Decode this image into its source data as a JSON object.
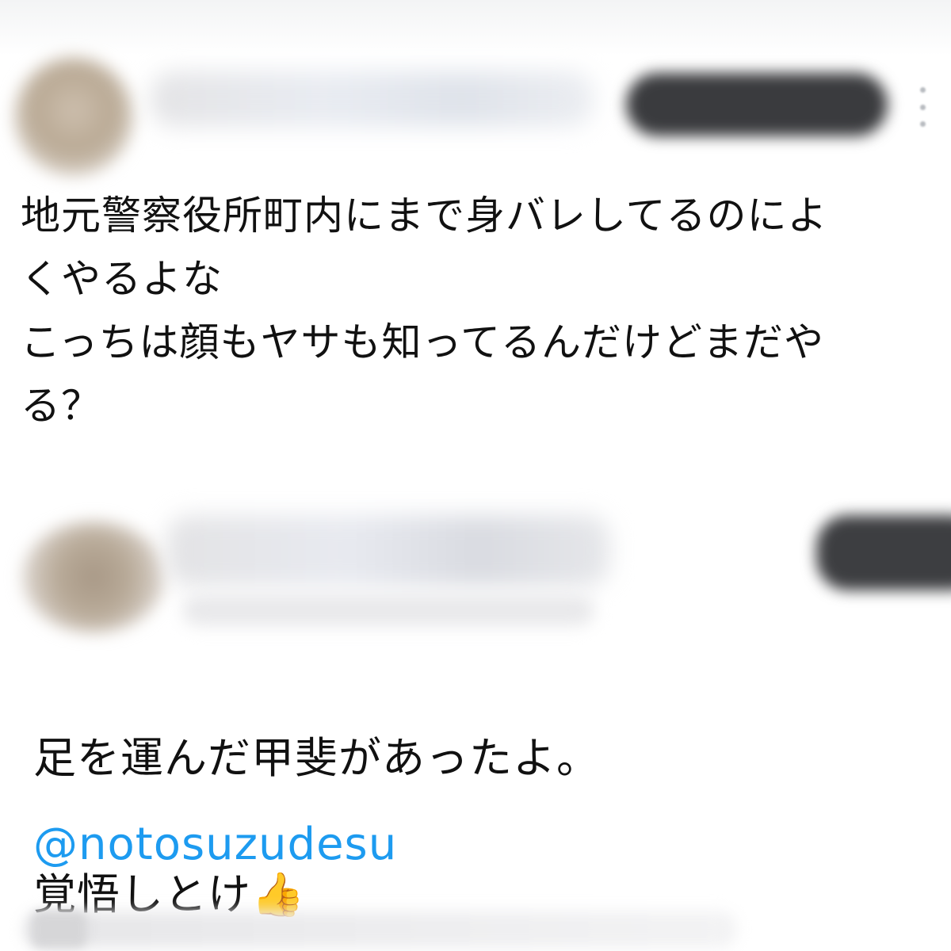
{
  "tweet_top": {
    "body": "地元警察役所町内にまで身バレしてるのによ\nくやるよな\nこっちは顔もヤサも知ってるんだけどまだや\nる？",
    "icons": {
      "avatar": "avatar-blurred",
      "more": "more-vertical-icon"
    }
  },
  "tweet_bottom": {
    "body_line1": "足を運んだ甲斐があったよ。",
    "body_line2": "覚悟しとけ",
    "emoji": "👍",
    "mention": "@notosuzudesu",
    "icons": {
      "avatar": "avatar-blurred"
    }
  },
  "colors": {
    "mention": "#1d9bf0",
    "text": "#111111",
    "follow_button_blurred": "#3a3b3e"
  }
}
